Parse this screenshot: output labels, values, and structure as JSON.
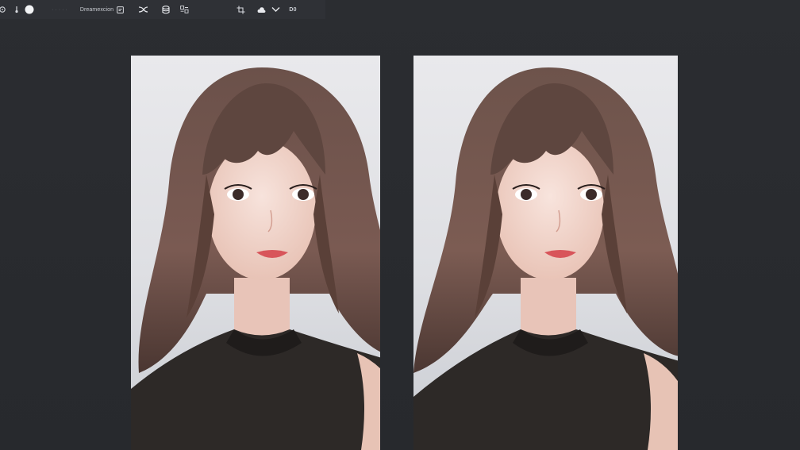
{
  "toolbar": {
    "document_label": "Dreamexcion",
    "zoom_value": "D0",
    "dots": "·····",
    "icons": [
      "gear-icon",
      "brush-icon",
      "circle-icon",
      "layers-icon",
      "shuffle-icon",
      "database-icon",
      "compare-icon",
      "crop-icon",
      "cloud-icon",
      "chevron-down-icon"
    ]
  },
  "images": [
    {
      "name": "original-portrait"
    },
    {
      "name": "edited-portrait"
    }
  ],
  "colors": {
    "background": "#2a2c30",
    "toolbar": "#2f3136",
    "photo_backdrop": "#e6e6e9"
  }
}
